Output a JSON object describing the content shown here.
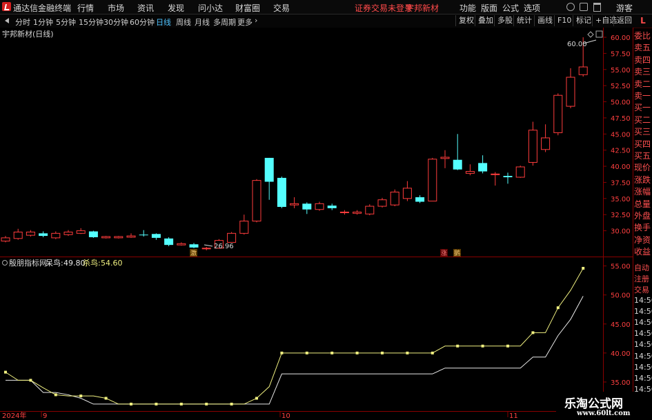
{
  "title_bar": {
    "app_title": "通达信金融终端",
    "menu": [
      "行情",
      "市场",
      "资讯",
      "发现",
      "问小达",
      "财富圈",
      "交易"
    ],
    "status": "证券交易未登录",
    "stock": "宇邦新材",
    "right_menu": [
      "功能",
      "版面",
      "公式",
      "选项"
    ],
    "guest": "游客"
  },
  "toolbar": {
    "periods": [
      "分时",
      "1分钟",
      "5分钟",
      "15分钟",
      "30分钟",
      "60分钟",
      "日线",
      "周线",
      "月线",
      "多周期",
      "更多"
    ],
    "active_period": "日线",
    "right_buttons": [
      "复权",
      "叠加",
      "多股",
      "统计",
      "画线",
      "F10",
      "标记",
      "+自选",
      "返回"
    ],
    "side_tag": "L"
  },
  "main_chart": {
    "label": "宇邦新材(日线)",
    "max_label": "60.00",
    "min_label": "26.96",
    "marks": [
      "激",
      "涨",
      "鹅"
    ],
    "y_ticks": [
      "60.00",
      "57.50",
      "55.00",
      "52.50",
      "50.00",
      "47.50",
      "45.00",
      "42.50",
      "40.00",
      "37.50",
      "35.00",
      "32.50",
      "30.00"
    ]
  },
  "indicator": {
    "name": "殷朋指标网",
    "line1_label": "呆鸟:",
    "line1_value": "49.80",
    "line2_label": "杀鸟:",
    "line2_value": "54.60",
    "y_ticks": [
      "55.00",
      "50.00",
      "45.00",
      "40.00",
      "35.00"
    ]
  },
  "x_axis": {
    "labels": [
      "2024年",
      "9",
      "10",
      "11"
    ]
  },
  "side_panel": {
    "items": [
      "委比",
      "卖五",
      "卖四",
      "卖三",
      "卖二",
      "卖一",
      "买一",
      "买二",
      "买三",
      "买四",
      "买五",
      "现价",
      "涨跌",
      "涨幅",
      "总量",
      "外盘",
      "换手",
      "净资",
      "收益"
    ],
    "lower_items": [
      "自动",
      "注册",
      "交易",
      "14:56",
      "14:56",
      "14:56",
      "14:56",
      "14:56",
      "14:56",
      "14:56",
      "14:56",
      "14:56"
    ]
  },
  "watermark": {
    "big": "乐淘公式网",
    "url": "www.60lt.com"
  },
  "colors": {
    "up": "#ff3c3c",
    "down": "#54ffff",
    "line_yellow": "#f0f080",
    "line_white": "#e8e8e8",
    "accent_red": "#ff4a4a"
  },
  "chart_data": {
    "type": "candlestick",
    "candles": [
      {
        "o": 28.4,
        "c": 28.9,
        "h": 29.2,
        "l": 28.2
      },
      {
        "o": 28.8,
        "c": 29.8,
        "h": 30.3,
        "l": 28.6
      },
      {
        "o": 29.3,
        "c": 29.8,
        "h": 30.1,
        "l": 29.1
      },
      {
        "o": 29.6,
        "c": 29.2,
        "h": 29.9,
        "l": 29.0
      },
      {
        "o": 28.9,
        "c": 29.6,
        "h": 29.9,
        "l": 28.7
      },
      {
        "o": 29.4,
        "c": 29.8,
        "h": 30.1,
        "l": 29.2
      },
      {
        "o": 29.6,
        "c": 30.0,
        "h": 30.4,
        "l": 29.5
      },
      {
        "o": 29.9,
        "c": 29.0,
        "h": 30.0,
        "l": 28.9
      },
      {
        "o": 28.9,
        "c": 29.1,
        "h": 29.2,
        "l": 28.8
      },
      {
        "o": 28.9,
        "c": 29.1,
        "h": 29.2,
        "l": 28.8
      },
      {
        "o": 29.0,
        "c": 29.2,
        "h": 29.6,
        "l": 28.9
      },
      {
        "o": 29.4,
        "c": 29.3,
        "h": 30.1,
        "l": 29.1
      },
      {
        "o": 29.5,
        "c": 28.9,
        "h": 29.6,
        "l": 28.6
      },
      {
        "o": 28.8,
        "c": 27.8,
        "h": 29.0,
        "l": 27.6
      },
      {
        "o": 27.8,
        "c": 28.0,
        "h": 28.2,
        "l": 27.7
      },
      {
        "o": 27.9,
        "c": 27.4,
        "h": 28.1,
        "l": 27.3
      },
      {
        "o": 27.3,
        "c": 27.3,
        "h": 27.5,
        "l": 26.96
      },
      {
        "o": 27.3,
        "c": 28.5,
        "h": 28.7,
        "l": 27.2
      },
      {
        "o": 28.2,
        "c": 29.6,
        "h": 29.8,
        "l": 28.2
      },
      {
        "o": 29.6,
        "c": 31.5,
        "h": 32.5,
        "l": 29.4
      },
      {
        "o": 31.5,
        "c": 37.8,
        "h": 38.0,
        "l": 31.3
      },
      {
        "o": 41.3,
        "c": 37.6,
        "h": 41.3,
        "l": 34.8
      },
      {
        "o": 38.2,
        "c": 33.7,
        "h": 38.4,
        "l": 33.5
      },
      {
        "o": 34.0,
        "c": 34.2,
        "h": 35.2,
        "l": 33.5
      },
      {
        "o": 34.2,
        "c": 33.3,
        "h": 34.4,
        "l": 32.6
      },
      {
        "o": 33.3,
        "c": 34.2,
        "h": 34.5,
        "l": 33.1
      },
      {
        "o": 33.9,
        "c": 33.5,
        "h": 34.2,
        "l": 33.2
      },
      {
        "o": 32.8,
        "c": 32.9,
        "h": 33.2,
        "l": 32.5
      },
      {
        "o": 32.7,
        "c": 32.9,
        "h": 33.2,
        "l": 32.5
      },
      {
        "o": 32.6,
        "c": 33.8,
        "h": 34.1,
        "l": 32.4
      },
      {
        "o": 33.8,
        "c": 34.8,
        "h": 35.1,
        "l": 33.6
      },
      {
        "o": 34.0,
        "c": 36.0,
        "h": 36.4,
        "l": 33.8
      },
      {
        "o": 35.0,
        "c": 36.6,
        "h": 37.7,
        "l": 34.6
      },
      {
        "o": 35.2,
        "c": 34.5,
        "h": 35.5,
        "l": 34.3
      },
      {
        "o": 34.6,
        "c": 41.1,
        "h": 41.3,
        "l": 34.6
      },
      {
        "o": 41.2,
        "c": 41.4,
        "h": 42.5,
        "l": 39.7
      },
      {
        "o": 41.0,
        "c": 39.5,
        "h": 45.0,
        "l": 39.4
      },
      {
        "o": 38.9,
        "c": 39.2,
        "h": 40.3,
        "l": 38.6
      },
      {
        "o": 40.5,
        "c": 39.2,
        "h": 41.7,
        "l": 38.9
      },
      {
        "o": 38.8,
        "c": 38.8,
        "h": 39.1,
        "l": 37.0
      },
      {
        "o": 38.5,
        "c": 38.3,
        "h": 39.0,
        "l": 37.3
      },
      {
        "o": 38.3,
        "c": 39.9,
        "h": 40.1,
        "l": 38.2
      },
      {
        "o": 40.6,
        "c": 45.6,
        "h": 46.9,
        "l": 40.1
      },
      {
        "o": 42.6,
        "c": 44.4,
        "h": 46.5,
        "l": 42.2
      },
      {
        "o": 45.2,
        "c": 51.0,
        "h": 51.3,
        "l": 44.8
      },
      {
        "o": 49.3,
        "c": 53.8,
        "h": 55.2,
        "l": 49.0
      },
      {
        "o": 54.2,
        "c": 55.4,
        "h": 60.0,
        "l": 53.9
      }
    ],
    "indicator_series": [
      {
        "name": "呆鸟",
        "values": [
          35.3,
          35.3,
          35.3,
          33.2,
          33.2,
          32.8,
          32.2,
          31.2,
          31.2,
          31.2,
          31.2,
          31.2,
          31.2,
          31.2,
          31.2,
          31.2,
          31.2,
          31.2,
          31.2,
          31.2,
          31.2,
          31.2,
          36.4,
          36.4,
          36.4,
          36.4,
          36.4,
          36.4,
          36.4,
          36.4,
          36.4,
          36.4,
          36.4,
          36.4,
          36.4,
          37.4,
          37.4,
          37.4,
          37.4,
          37.4,
          37.4,
          37.4,
          39.3,
          39.3,
          43.0,
          45.8,
          49.8
        ]
      },
      {
        "name": "杀鸟",
        "values": [
          36.7,
          35.3,
          35.3,
          34.0,
          32.8,
          32.6,
          32.6,
          32.6,
          32.2,
          31.2,
          31.2,
          31.2,
          31.2,
          31.2,
          31.2,
          31.2,
          31.2,
          31.2,
          31.2,
          31.2,
          32.2,
          34.2,
          40.0,
          40.0,
          40.0,
          40.0,
          40.0,
          40.0,
          40.0,
          40.0,
          40.0,
          40.0,
          40.0,
          40.0,
          40.0,
          41.2,
          41.2,
          41.2,
          41.2,
          41.2,
          41.2,
          41.2,
          43.5,
          43.5,
          47.8,
          50.8,
          54.6
        ]
      }
    ],
    "price_ylim": [
      26.0,
      61.5
    ],
    "indicator_ylim": [
      30.0,
      56.5
    ]
  }
}
